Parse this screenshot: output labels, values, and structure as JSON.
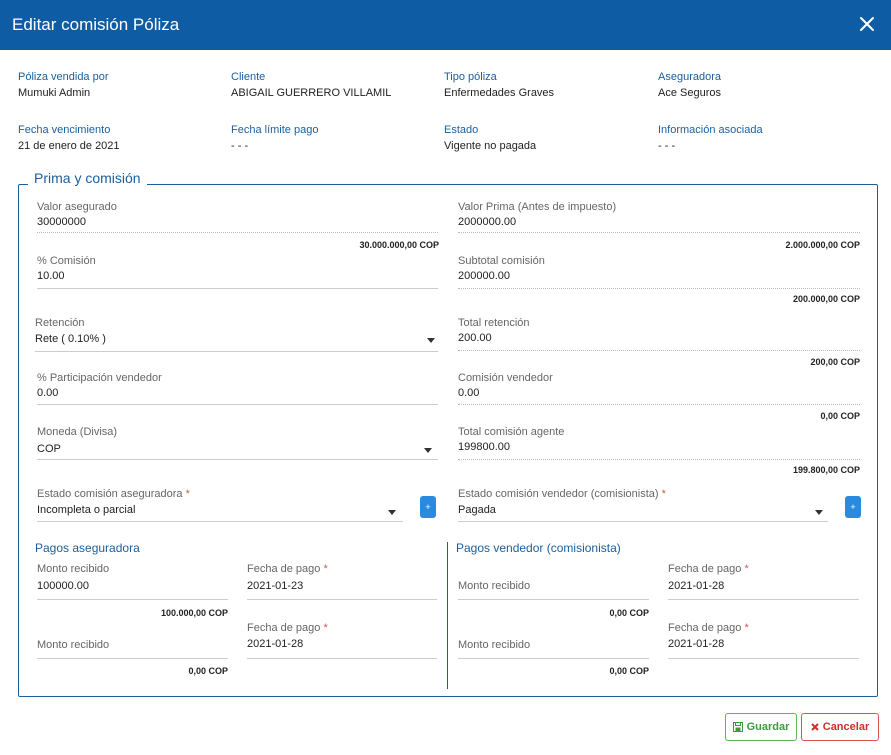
{
  "header": {
    "title": "Editar comisión Póliza"
  },
  "info": [
    {
      "label": "Póliza vendida por",
      "value": "Mumuki Admin"
    },
    {
      "label": "Cliente",
      "value": "ABIGAIL GUERRERO VILLAMIL"
    },
    {
      "label": "Tipo póliza",
      "value": "Enfermedades Graves"
    },
    {
      "label": "Aseguradora",
      "value": "Ace Seguros"
    },
    {
      "label": "Fecha vencimiento",
      "value": "21 de enero de 2021"
    },
    {
      "label": "Fecha límite pago",
      "value": "- - -"
    },
    {
      "label": "Estado",
      "value": "Vigente no pagada"
    },
    {
      "label": "Información asociada",
      "value": "- - -"
    }
  ],
  "section": {
    "title": "Prima y comisión",
    "valor_asegurado": {
      "label": "Valor asegurado",
      "value": "30000000",
      "formatted": "30.000.000,00 COP"
    },
    "valor_prima": {
      "label": "Valor Prima (Antes de impuesto)",
      "value": "2000000.00",
      "formatted": "2.000.000,00 COP"
    },
    "comision": {
      "label": "% Comisión",
      "value": "10.00"
    },
    "subtotal_comision": {
      "label": "Subtotal comisión",
      "value": "200000.00",
      "formatted": "200.000,00 COP"
    },
    "retencion": {
      "label": "Retención",
      "value": "Rete ( 0.10% )"
    },
    "total_retencion": {
      "label": "Total retención",
      "value": "200.00",
      "formatted": "200,00 COP"
    },
    "participacion": {
      "label": "% Participación vendedor",
      "value": "0.00"
    },
    "comision_vendedor": {
      "label": "Comisión vendedor",
      "value": "0.00",
      "formatted": "0,00 COP"
    },
    "moneda": {
      "label": "Moneda (Divisa)",
      "value": "COP"
    },
    "total_comision_agente": {
      "label": "Total comisión agente",
      "value": "199800.00",
      "formatted": "199.800,00 COP"
    },
    "estado_aseguradora": {
      "label": "Estado comisión aseguradora",
      "required": "*",
      "value": "Incompleta o parcial",
      "add": "+"
    },
    "estado_vendedor": {
      "label": "Estado comisión vendedor (comisionista)",
      "required": "*",
      "value": "Pagada",
      "add": "+"
    }
  },
  "pagos_aseguradora": {
    "title": "Pagos aseguradora",
    "rows": [
      {
        "monto_label": "Monto recibido",
        "monto_value": "100000.00",
        "monto_formatted": "100.000,00 COP",
        "fecha_label": "Fecha de pago",
        "required": "*",
        "fecha_value": "2021-01-23"
      },
      {
        "monto_label": "Monto recibido",
        "monto_value": "",
        "monto_formatted": "0,00 COP",
        "fecha_label": "Fecha de pago",
        "required": "*",
        "fecha_value": "2021-01-28"
      }
    ]
  },
  "pagos_vendedor": {
    "title": "Pagos vendedor (comisionista)",
    "rows": [
      {
        "monto_label": "Monto recibido",
        "monto_value": "",
        "monto_formatted": "0,00 COP",
        "fecha_label": "Fecha de pago",
        "required": "*",
        "fecha_value": "2021-01-28"
      },
      {
        "monto_label": "Monto recibido",
        "monto_value": "",
        "monto_formatted": "0,00 COP",
        "fecha_label": "Fecha de pago",
        "required": "*",
        "fecha_value": "2021-01-28"
      }
    ]
  },
  "footer": {
    "save_label": "Guardar",
    "cancel_label": "Cancelar"
  },
  "colors": {
    "header": "#0e5ca4",
    "accent": "#1a5f9e",
    "save": "#5cb85c",
    "cancel": "#d9534f",
    "plus": "#2a8ae0"
  },
  "icons": {
    "close": "close-icon",
    "save": "floppy-disk-icon",
    "cancel": "x-icon",
    "dropdown": "caret-down-icon"
  }
}
